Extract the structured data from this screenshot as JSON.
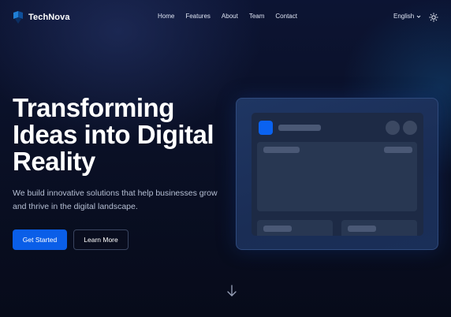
{
  "brand": {
    "name": "TechNova",
    "logo_icon": "technova-logo-icon"
  },
  "nav": {
    "items": [
      {
        "label": "Home"
      },
      {
        "label": "Features"
      },
      {
        "label": "About"
      },
      {
        "label": "Team"
      },
      {
        "label": "Contact"
      }
    ],
    "language": "English",
    "language_icon": "chevron-down-icon",
    "theme_icon": "sun-icon"
  },
  "hero": {
    "title": "Transforming Ideas into Digital Reality",
    "subtitle": "We build innovative solutions that help businesses grow and thrive in the digital landscape.",
    "primary_cta": "Get Started",
    "secondary_cta": "Learn More",
    "scroll_icon": "arrow-down-icon"
  },
  "colors": {
    "accent": "#0a5ee8",
    "background_dark": "#0a1026",
    "mockup_card": "#1f3663"
  }
}
